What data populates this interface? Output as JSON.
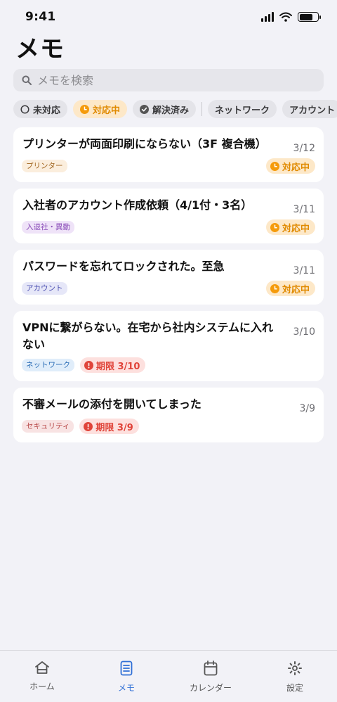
{
  "status": {
    "time": "9:41"
  },
  "header": {
    "title": "メモ"
  },
  "search": {
    "placeholder": "メモを検索"
  },
  "filters": {
    "status": [
      {
        "label": "未対応",
        "icon": "circle-outline-icon"
      },
      {
        "label": "対応中",
        "icon": "clock-icon",
        "active": true
      },
      {
        "label": "解決済み",
        "icon": "check-circle-icon"
      }
    ],
    "categories": [
      "ネットワーク",
      "アカウント"
    ]
  },
  "memos": [
    {
      "title": "プリンターが両面印刷にならない（3F 複合機）",
      "date": "3/12",
      "tag": "プリンター",
      "badge": "対応中"
    },
    {
      "title": "入社者のアカウント作成依頼（4/1付・3名）",
      "date": "3/11",
      "tag": "入退社・異動",
      "badge": "対応中"
    },
    {
      "title": "パスワードを忘れてロックされた。至急",
      "date": "3/11",
      "tag": "アカウント",
      "badge": "対応中"
    },
    {
      "title": "VPNに繋がらない。在宅から社内システムに入れない",
      "date": "3/10",
      "tag": "ネットワーク",
      "badge": "期限 3/10"
    },
    {
      "title": "不審メールの添付を開いてしまった",
      "date": "3/9",
      "tag": "セキュリティ",
      "badge": "期限 3/9"
    }
  ],
  "tabbar": {
    "home": "ホーム",
    "memo": "メモ",
    "calendar": "カレンダー",
    "settings": "設定"
  },
  "colors": {
    "accent": "#2f6fd6",
    "in_progress": "#e08a00",
    "deadline": "#e0443a"
  }
}
